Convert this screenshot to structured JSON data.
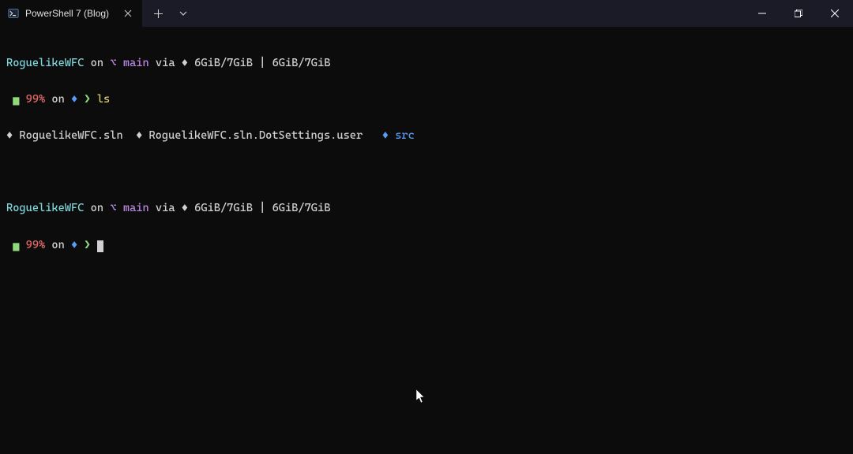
{
  "titlebar": {
    "tab": {
      "title": "PowerShell 7 (Blog)"
    }
  },
  "terminal": {
    "prompt1": {
      "dir": "RoguelikeWFC",
      "on": " on ",
      "branch_glyph": "⌥ ",
      "branch": "main",
      "via": " via ",
      "via_glyph": "♦ ",
      "mem": "6GiB/7GiB | 6GiB/7GiB",
      "battery_glyph": "▅",
      "battery": " 99%",
      "on2": " on ",
      "diamond": "♦ ",
      "arrow": "❯ ",
      "command": "ls"
    },
    "ls_output": {
      "glyph1": "♦ ",
      "file1": "RoguelikeWFC.sln",
      "sep1": "  ",
      "glyph2": "♦ ",
      "file2": "RoguelikeWFC.sln.DotSettings.user",
      "sep2": "   ",
      "glyph3": "♦ ",
      "dir1": "src"
    },
    "prompt2": {
      "dir": "RoguelikeWFC",
      "on": " on ",
      "branch_glyph": "⌥ ",
      "branch": "main",
      "via": " via ",
      "via_glyph": "♦ ",
      "mem": "6GiB/7GiB | 6GiB/7GiB",
      "battery_glyph": "▅",
      "battery": " 99%",
      "on2": " on ",
      "diamond": "♦ ",
      "arrow": "❯ "
    }
  }
}
